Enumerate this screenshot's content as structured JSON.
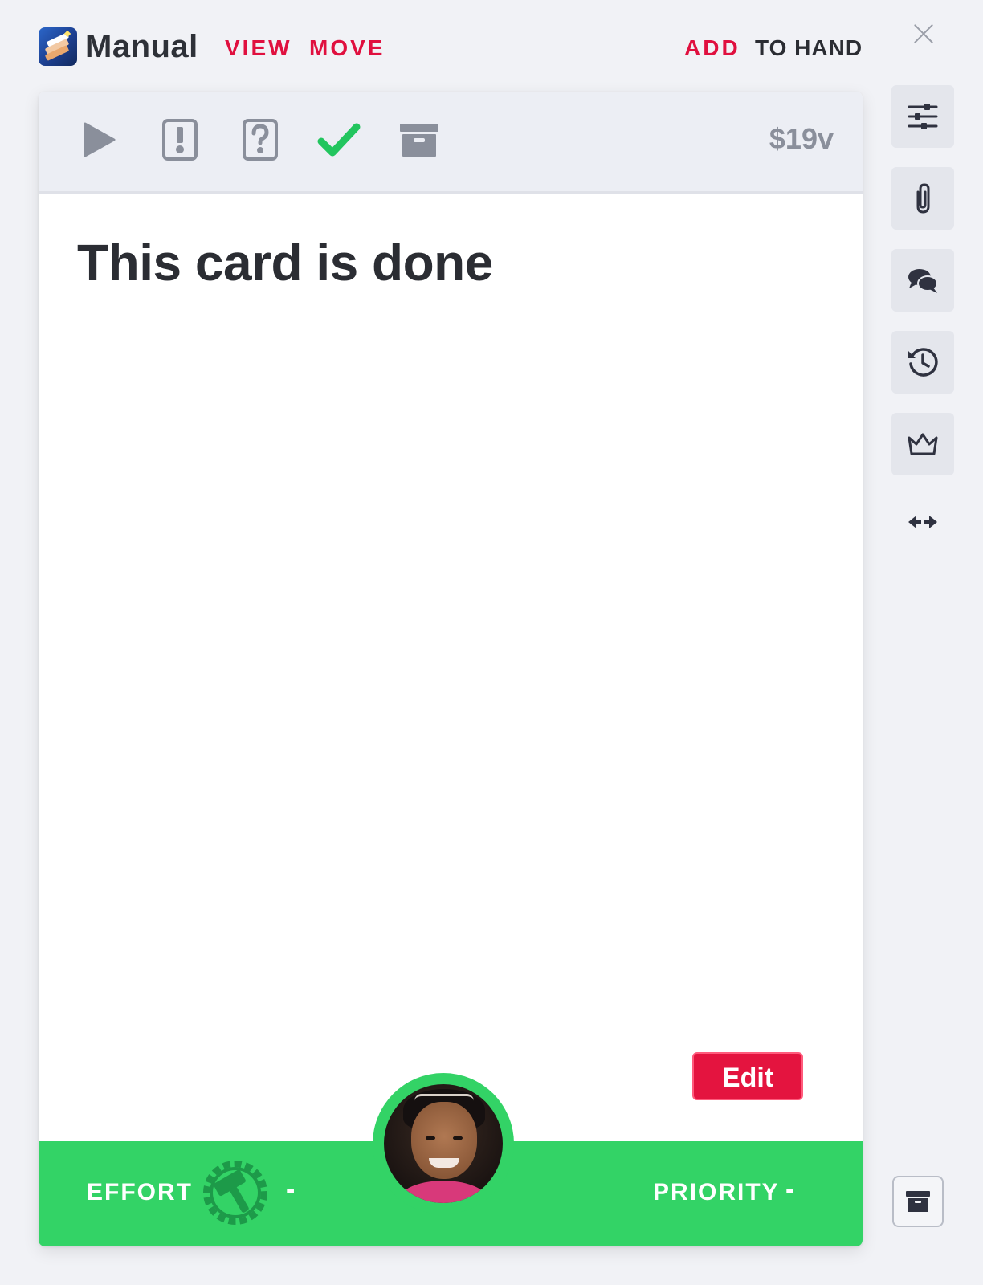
{
  "header": {
    "title": "Manual",
    "view_label": "VIEW",
    "move_label": "MOVE",
    "add_label": "ADD",
    "to_hand_label": "TO HAND",
    "icons": {
      "logo": "manual-logo",
      "close": "close-icon"
    }
  },
  "card": {
    "toolbar": {
      "icons": [
        "play-icon",
        "blocked-icon",
        "question-icon",
        "check-icon",
        "archive-icon"
      ],
      "cost": "$19v"
    },
    "title": "This card is done",
    "edit_label": "Edit",
    "footer": {
      "effort_label": "EFFORT",
      "effort_value": "-",
      "priority_label": "PRIORITY",
      "priority_value": "-",
      "color": "#33d366"
    }
  },
  "sidebar": {
    "icons": [
      "sliders-icon",
      "paperclip-icon",
      "comments-icon",
      "history-icon",
      "crown-icon",
      "expand-horizontal-icon",
      "archive-icon"
    ]
  },
  "colors": {
    "accent_red": "#e0103f",
    "done_green": "#33d366",
    "check_green": "#22c55e"
  }
}
